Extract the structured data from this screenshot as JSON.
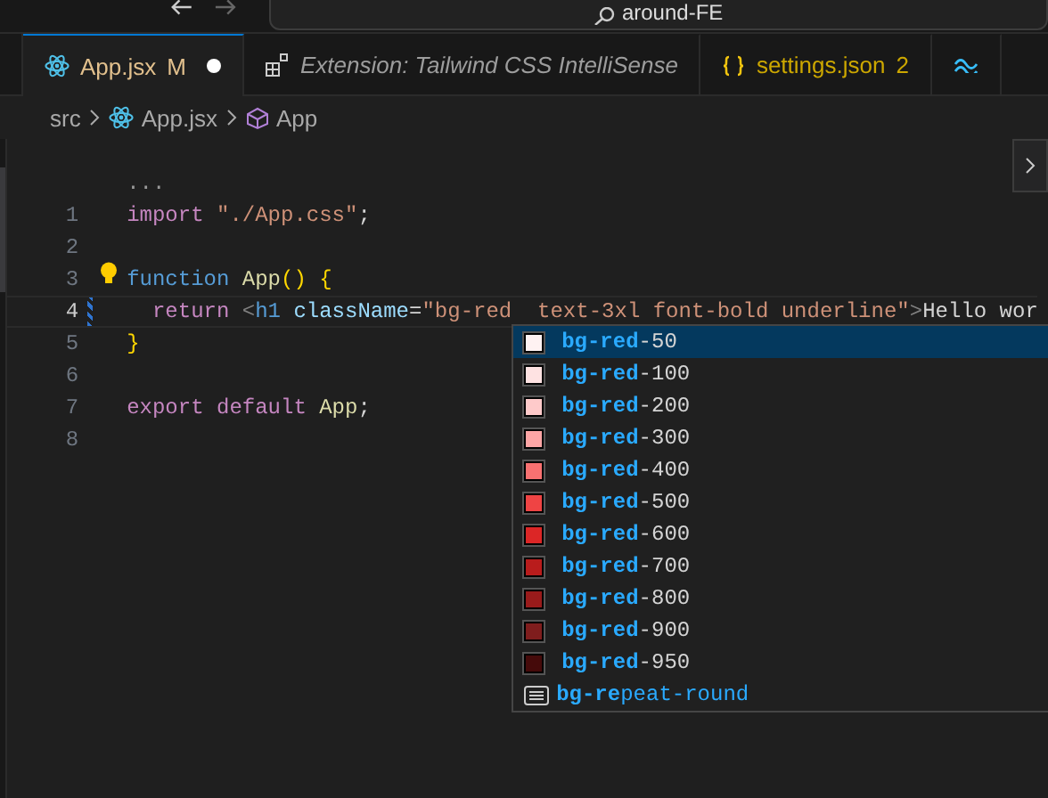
{
  "title_bar": {
    "search": "around-FE"
  },
  "tabs": [
    {
      "label": "App.jsx",
      "badge": "M",
      "kind": "react",
      "selected": true,
      "modified": true,
      "preview": false
    },
    {
      "label": "Extension: Tailwind CSS IntelliSense",
      "kind": "extension",
      "selected": false,
      "modified": false,
      "preview": true
    },
    {
      "label": "settings.json",
      "badge": "2",
      "kind": "json",
      "selected": false,
      "modified": false,
      "preview": false
    },
    {
      "kind": "tailwind",
      "selected": false,
      "modified": false,
      "preview": false
    }
  ],
  "breadcrumb": [
    {
      "label": "src",
      "kind": "folder"
    },
    {
      "label": "App.jsx",
      "kind": "react"
    },
    {
      "label": "App",
      "kind": "component"
    }
  ],
  "codelens": "...",
  "lines": [
    {
      "number": "1",
      "active": false,
      "tokens": [
        {
          "t": "import ",
          "kind": "kw"
        },
        {
          "t": "\"./App.css\"",
          "kind": "str"
        },
        {
          "t": ";",
          "kind": "plain"
        }
      ]
    },
    {
      "number": "2",
      "active": false
    },
    {
      "number": "3",
      "active": false,
      "tokens": [
        {
          "t": "function ",
          "kind": "decl"
        },
        {
          "t": "App",
          "kind": "fn"
        },
        {
          "t": "() {",
          "kind": "brace"
        }
      ]
    },
    {
      "number": "4",
      "active": true,
      "tokens": [
        {
          "t": "return ",
          "kind": "kw"
        },
        {
          "t": "<",
          "kind": "punct"
        },
        {
          "t": "h1",
          "kind": "tag"
        },
        {
          "t": " className",
          "kind": "attr"
        },
        {
          "t": "=",
          "kind": "plain"
        },
        {
          "t": "\"bg-red  text-3xl font-bold underline\"",
          "kind": "str"
        },
        {
          "t": ">",
          "kind": "punct"
        },
        {
          "t": "Hello wor",
          "kind": "plain"
        }
      ]
    },
    {
      "number": "5",
      "active": false,
      "tokens": [
        {
          "t": "}",
          "kind": "brace"
        }
      ]
    },
    {
      "number": "6",
      "active": false
    },
    {
      "number": "7",
      "active": false,
      "tokens": [
        {
          "t": "export default ",
          "kind": "kw"
        },
        {
          "t": "App",
          "kind": "fn"
        },
        {
          "t": ";",
          "kind": "plain"
        }
      ]
    },
    {
      "number": "8",
      "active": false
    }
  ],
  "suggestions": [
    {
      "match": "bg-red",
      "rest": "-50",
      "kind": "color",
      "color": "#fef2f2",
      "selected": true
    },
    {
      "match": "bg-red",
      "rest": "-100",
      "kind": "color",
      "color": "#fee2e2",
      "selected": false
    },
    {
      "match": "bg-red",
      "rest": "-200",
      "kind": "color",
      "color": "#fecaca",
      "selected": false
    },
    {
      "match": "bg-red",
      "rest": "-300",
      "kind": "color",
      "color": "#fca5a5",
      "selected": false
    },
    {
      "match": "bg-red",
      "rest": "-400",
      "kind": "color",
      "color": "#f87171",
      "selected": false
    },
    {
      "match": "bg-red",
      "rest": "-500",
      "kind": "color",
      "color": "#ef4444",
      "selected": false
    },
    {
      "match": "bg-red",
      "rest": "-600",
      "kind": "color",
      "color": "#dc2626",
      "selected": false
    },
    {
      "match": "bg-red",
      "rest": "-700",
      "kind": "color",
      "color": "#b91c1c",
      "selected": false
    },
    {
      "match": "bg-red",
      "rest": "-800",
      "kind": "color",
      "color": "#991b1b",
      "selected": false
    },
    {
      "match": "bg-red",
      "rest": "-900",
      "kind": "color",
      "color": "#7f1d1d",
      "selected": false
    },
    {
      "match": "bg-red",
      "rest": "-950",
      "kind": "color",
      "color": "#450a0a",
      "selected": false
    },
    {
      "match": "bg-re",
      "rest": "peat-round",
      "kind": "text",
      "selected": false
    }
  ]
}
